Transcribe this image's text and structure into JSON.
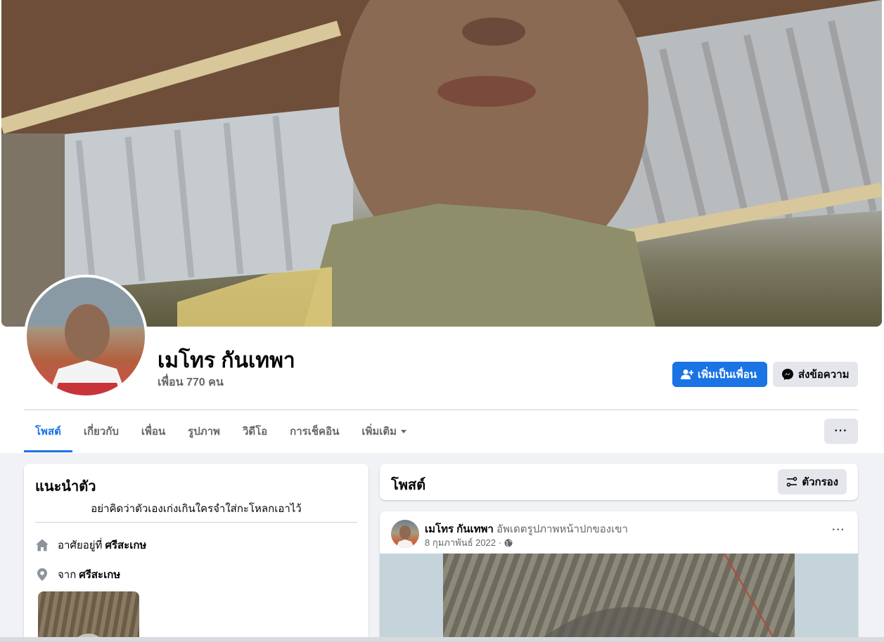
{
  "profile": {
    "name": "เมโทร กันเทพา",
    "friends_count": "เพื่อน 770 คน"
  },
  "actions": {
    "add_friend": "เพิ่มเป็นเพื่อน",
    "message": "ส่งข้อความ",
    "more": "···"
  },
  "tabs": [
    {
      "label": "โพสต์",
      "active": true
    },
    {
      "label": "เกี่ยวกับ"
    },
    {
      "label": "เพื่อน"
    },
    {
      "label": "รูปภาพ"
    },
    {
      "label": "วิดีโอ"
    },
    {
      "label": "การเช็คอิน"
    },
    {
      "label": "เพิ่มเติม"
    }
  ],
  "intro": {
    "title": "แนะนำตัว",
    "bio": "อย่าคิดว่าตัวเองเก่งเกินใครจำใส่กะโหลกเอาไว้",
    "lives_in_prefix": "อาศัยอยู่ที่",
    "lives_in_value": "ศรีสะเกษ",
    "from_prefix": "จาก",
    "from_value": "ศรีสะเกษ"
  },
  "posts": {
    "title": "โพสต์",
    "filter_label": "ตัวกรอง",
    "items": [
      {
        "author": "เมโทร กันเทพา",
        "action": "อัพเดตรูปภาพหน้าปกของเขา",
        "date": "8 กุมภาพันธ์ 2022 ·",
        "more": "···"
      }
    ]
  },
  "colors": {
    "accent": "#1b74e4",
    "button_gray": "#e4e6eb",
    "background": "#f0f2f5",
    "secondary_text": "#65676b"
  }
}
